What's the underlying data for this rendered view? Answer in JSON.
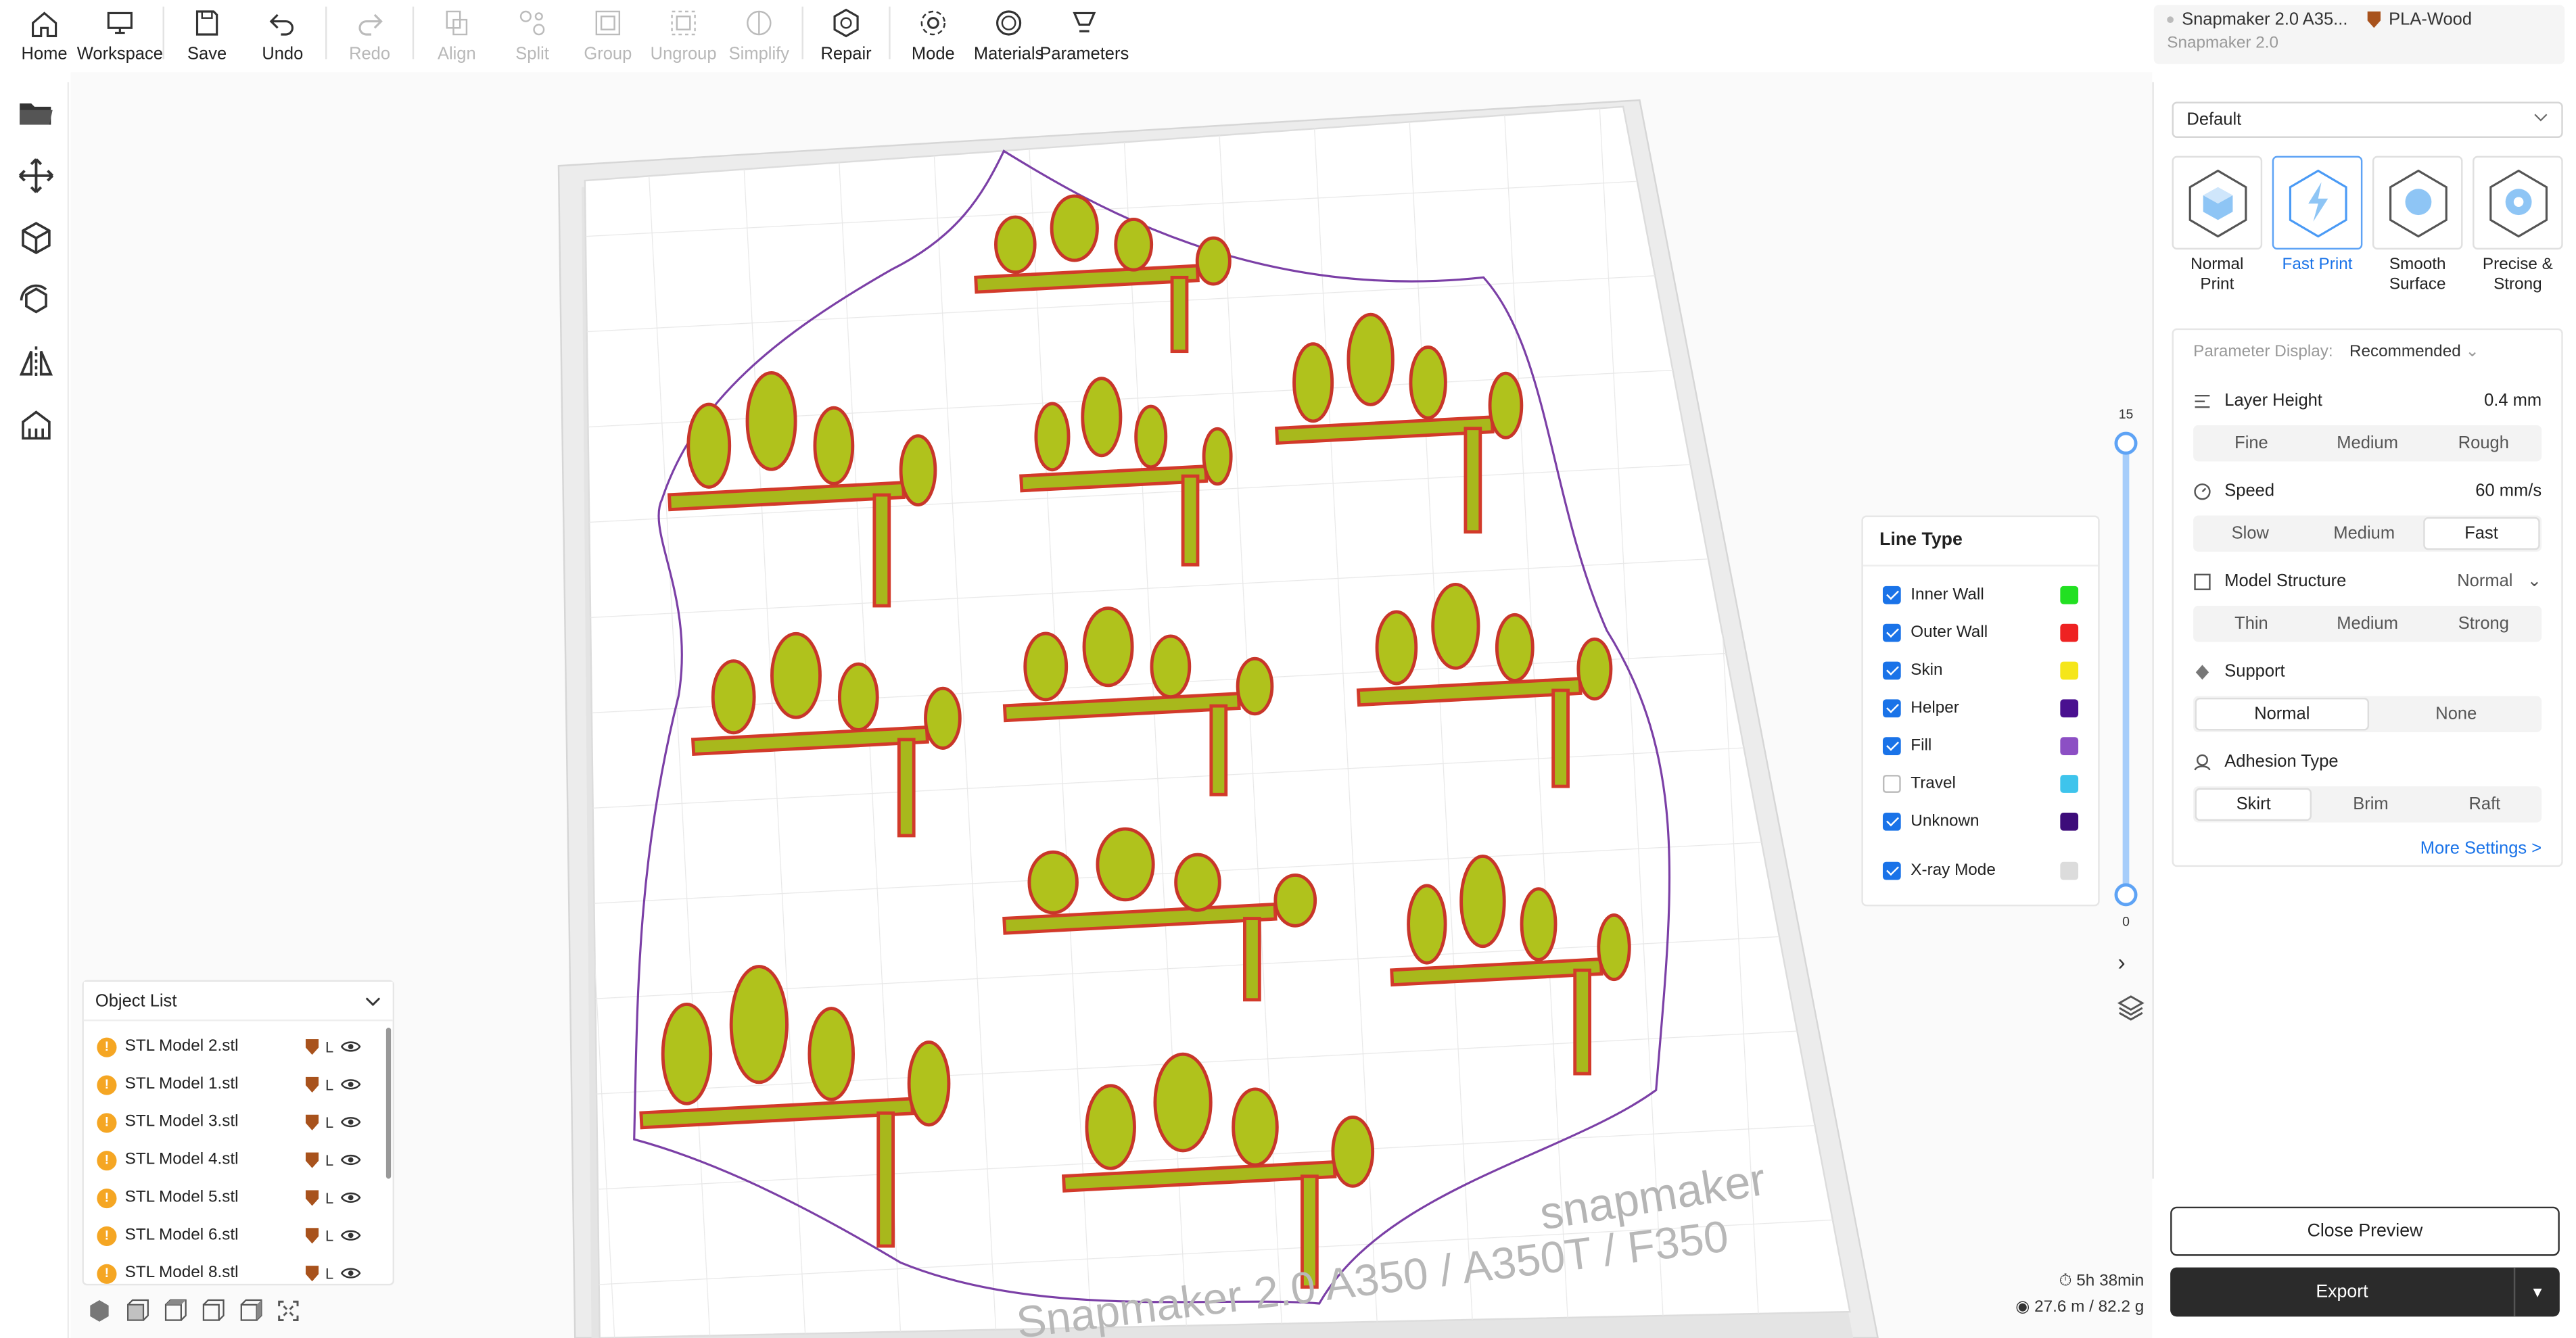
{
  "toolbar": {
    "items": [
      {
        "label": "Home",
        "icon": "home-icon",
        "enabled": true
      },
      {
        "label": "Workspace",
        "icon": "workspace-icon",
        "enabled": true
      },
      {
        "label": "Save",
        "icon": "save-icon",
        "enabled": true
      },
      {
        "label": "Undo",
        "icon": "undo-icon",
        "enabled": true
      },
      {
        "label": "Redo",
        "icon": "redo-icon",
        "enabled": false
      },
      {
        "label": "Align",
        "icon": "align-icon",
        "enabled": false
      },
      {
        "label": "Split",
        "icon": "split-icon",
        "enabled": false
      },
      {
        "label": "Group",
        "icon": "group-icon",
        "enabled": false
      },
      {
        "label": "Ungroup",
        "icon": "ungroup-icon",
        "enabled": false
      },
      {
        "label": "Simplify",
        "icon": "simplify-icon",
        "enabled": false
      },
      {
        "label": "Repair",
        "icon": "repair-icon",
        "enabled": true
      },
      {
        "label": "Mode",
        "icon": "mode-icon",
        "enabled": true
      },
      {
        "label": "Materials",
        "icon": "materials-icon",
        "enabled": true
      },
      {
        "label": "Parameters",
        "icon": "parameters-icon",
        "enabled": true
      }
    ]
  },
  "machine": {
    "name": "Snapmaker 2.0 A35...",
    "material": "PLA-Wood",
    "model": "Snapmaker 2.0"
  },
  "left_tools": [
    "open-folder-icon",
    "move-icon",
    "scale-icon",
    "rotate-icon",
    "mirror-icon",
    "support-icon"
  ],
  "viewport": {
    "brand": "snapmaker",
    "printer_label": "Snapmaker 2.0 A350 / A350T / F350"
  },
  "object_list": {
    "title": "Object List",
    "items": [
      {
        "name": "STL Model 2.stl",
        "tag": "L"
      },
      {
        "name": "STL Model 1.stl",
        "tag": "L"
      },
      {
        "name": "STL Model 3.stl",
        "tag": "L"
      },
      {
        "name": "STL Model 4.stl",
        "tag": "L"
      },
      {
        "name": "STL Model 5.stl",
        "tag": "L"
      },
      {
        "name": "STL Model 6.stl",
        "tag": "L"
      },
      {
        "name": "STL Model 8.stl",
        "tag": "L"
      }
    ]
  },
  "line_type": {
    "title": "Line Type",
    "items": [
      {
        "label": "Inner Wall",
        "checked": true,
        "color": "#22e022"
      },
      {
        "label": "Outer Wall",
        "checked": true,
        "color": "#ee2222"
      },
      {
        "label": "Skin",
        "checked": true,
        "color": "#f5e61a"
      },
      {
        "label": "Helper",
        "checked": true,
        "color": "#4a1090"
      },
      {
        "label": "Fill",
        "checked": true,
        "color": "#8c4fc4"
      },
      {
        "label": "Travel",
        "checked": false,
        "color": "#3ec4ec"
      },
      {
        "label": "Unknown",
        "checked": true,
        "color": "#3d0c7a"
      },
      {
        "label": "X-ray Mode",
        "checked": true,
        "color": "#dcdcdc"
      }
    ]
  },
  "layer_slider": {
    "max": "15",
    "min": "0",
    "value_top": 15,
    "value_bottom": 0
  },
  "stats": {
    "time": "5h 38min",
    "usage": "27.6 m / 82.2 g"
  },
  "right_panel": {
    "preset_select": "Default",
    "presets": [
      {
        "label": "Normal Print",
        "icon": "normal-print-icon",
        "active": false
      },
      {
        "label": "Fast Print",
        "icon": "fast-print-icon",
        "active": true
      },
      {
        "label": "Smooth Surface",
        "icon": "smooth-surface-icon",
        "active": false
      },
      {
        "label": "Precise & Strong",
        "icon": "precise-strong-icon",
        "active": false
      }
    ],
    "param_display_label": "Parameter Display:",
    "param_display_value": "Recommended",
    "layer_height": {
      "label": "Layer Height",
      "value": "0.4 mm",
      "options": [
        "Fine",
        "Medium",
        "Rough"
      ],
      "selected": -1
    },
    "speed": {
      "label": "Speed",
      "value": "60 mm/s",
      "options": [
        "Slow",
        "Medium",
        "Fast"
      ],
      "selected": 2
    },
    "model_structure": {
      "label": "Model Structure",
      "value": "Normal",
      "options": [
        "Thin",
        "Medium",
        "Strong"
      ],
      "selected": -1
    },
    "support": {
      "label": "Support",
      "options": [
        "Normal",
        "None"
      ],
      "selected": 0
    },
    "adhesion": {
      "label": "Adhesion Type",
      "options": [
        "Skirt",
        "Brim",
        "Raft"
      ],
      "selected": 0
    },
    "more_settings": "More Settings >"
  },
  "buttons": {
    "close_preview": "Close Preview",
    "export": "Export"
  }
}
